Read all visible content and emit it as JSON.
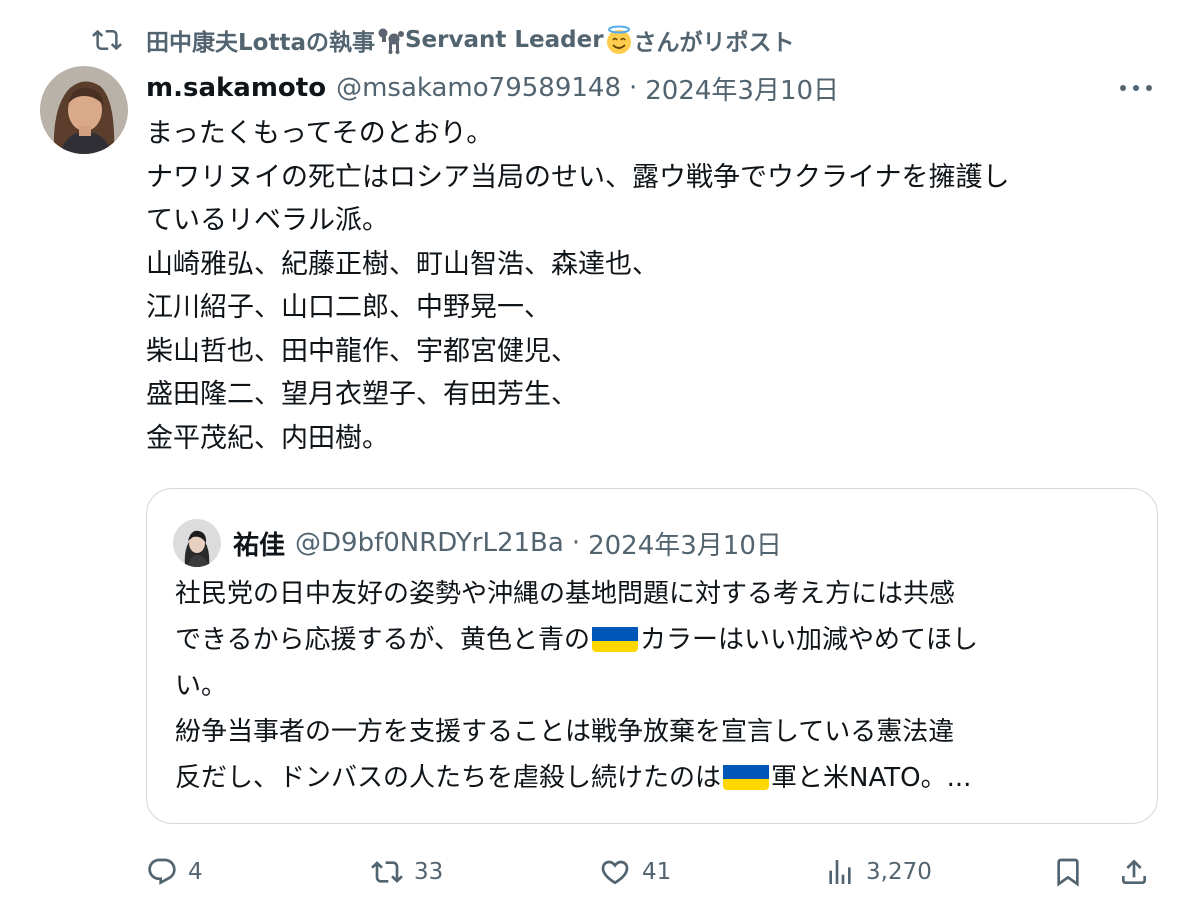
{
  "repost_banner": {
    "user_name": "田中康夫Lottaの執事",
    "user_suffix": "Servant Leader",
    "action_text": "さんがリポスト",
    "emojis": [
      "poodle",
      "smiling-face-with-halo"
    ]
  },
  "tweet": {
    "display_name": "m.sakamoto",
    "handle": "@msakamo79589148",
    "separator": "·",
    "date": "2024年3月10日",
    "lines": [
      "まったくもってそのとおり。",
      "ナワリヌイの死亡はロシア当局のせい、露ウ戦争でウクライナを擁護し",
      "ているリベラル派。",
      "山崎雅弘、紀藤正樹、町山智浩、森達也、",
      "江川紹子、山口二郎、中野晃一、",
      "柴山哲也、田中龍作、宇都宮健児、",
      "盛田隆二、望月衣塑子、有田芳生、",
      "金平茂紀、内田樹。"
    ]
  },
  "quote": {
    "display_name": "祐佳",
    "handle": "@D9bf0NRDYrL21Ba",
    "separator": "·",
    "date": "2024年3月10日",
    "line1": "社民党の日中友好の姿勢や沖縄の基地問題に対する考え方には共感",
    "line2_before_flag": "できるから応援するが、黄色と青の",
    "line2_after_flag": "カラーはいい加減やめてほし",
    "line3": "い。",
    "line4": "紛争当事者の一方を支援することは戦争放棄を宣言している憲法違",
    "line5_before_flag": "反だし、ドンバスの人たちを虐殺し続けたのは",
    "line5_after_flag": "軍と米NATO。...",
    "flag_colors": [
      "#0057b7",
      "#ffd700"
    ]
  },
  "actions": {
    "reply_count": "4",
    "repost_count": "33",
    "like_count": "41",
    "view_count": "3,270"
  },
  "colors": {
    "text_primary": "#0f1419",
    "text_secondary": "#536471",
    "border": "#cfd9de"
  }
}
